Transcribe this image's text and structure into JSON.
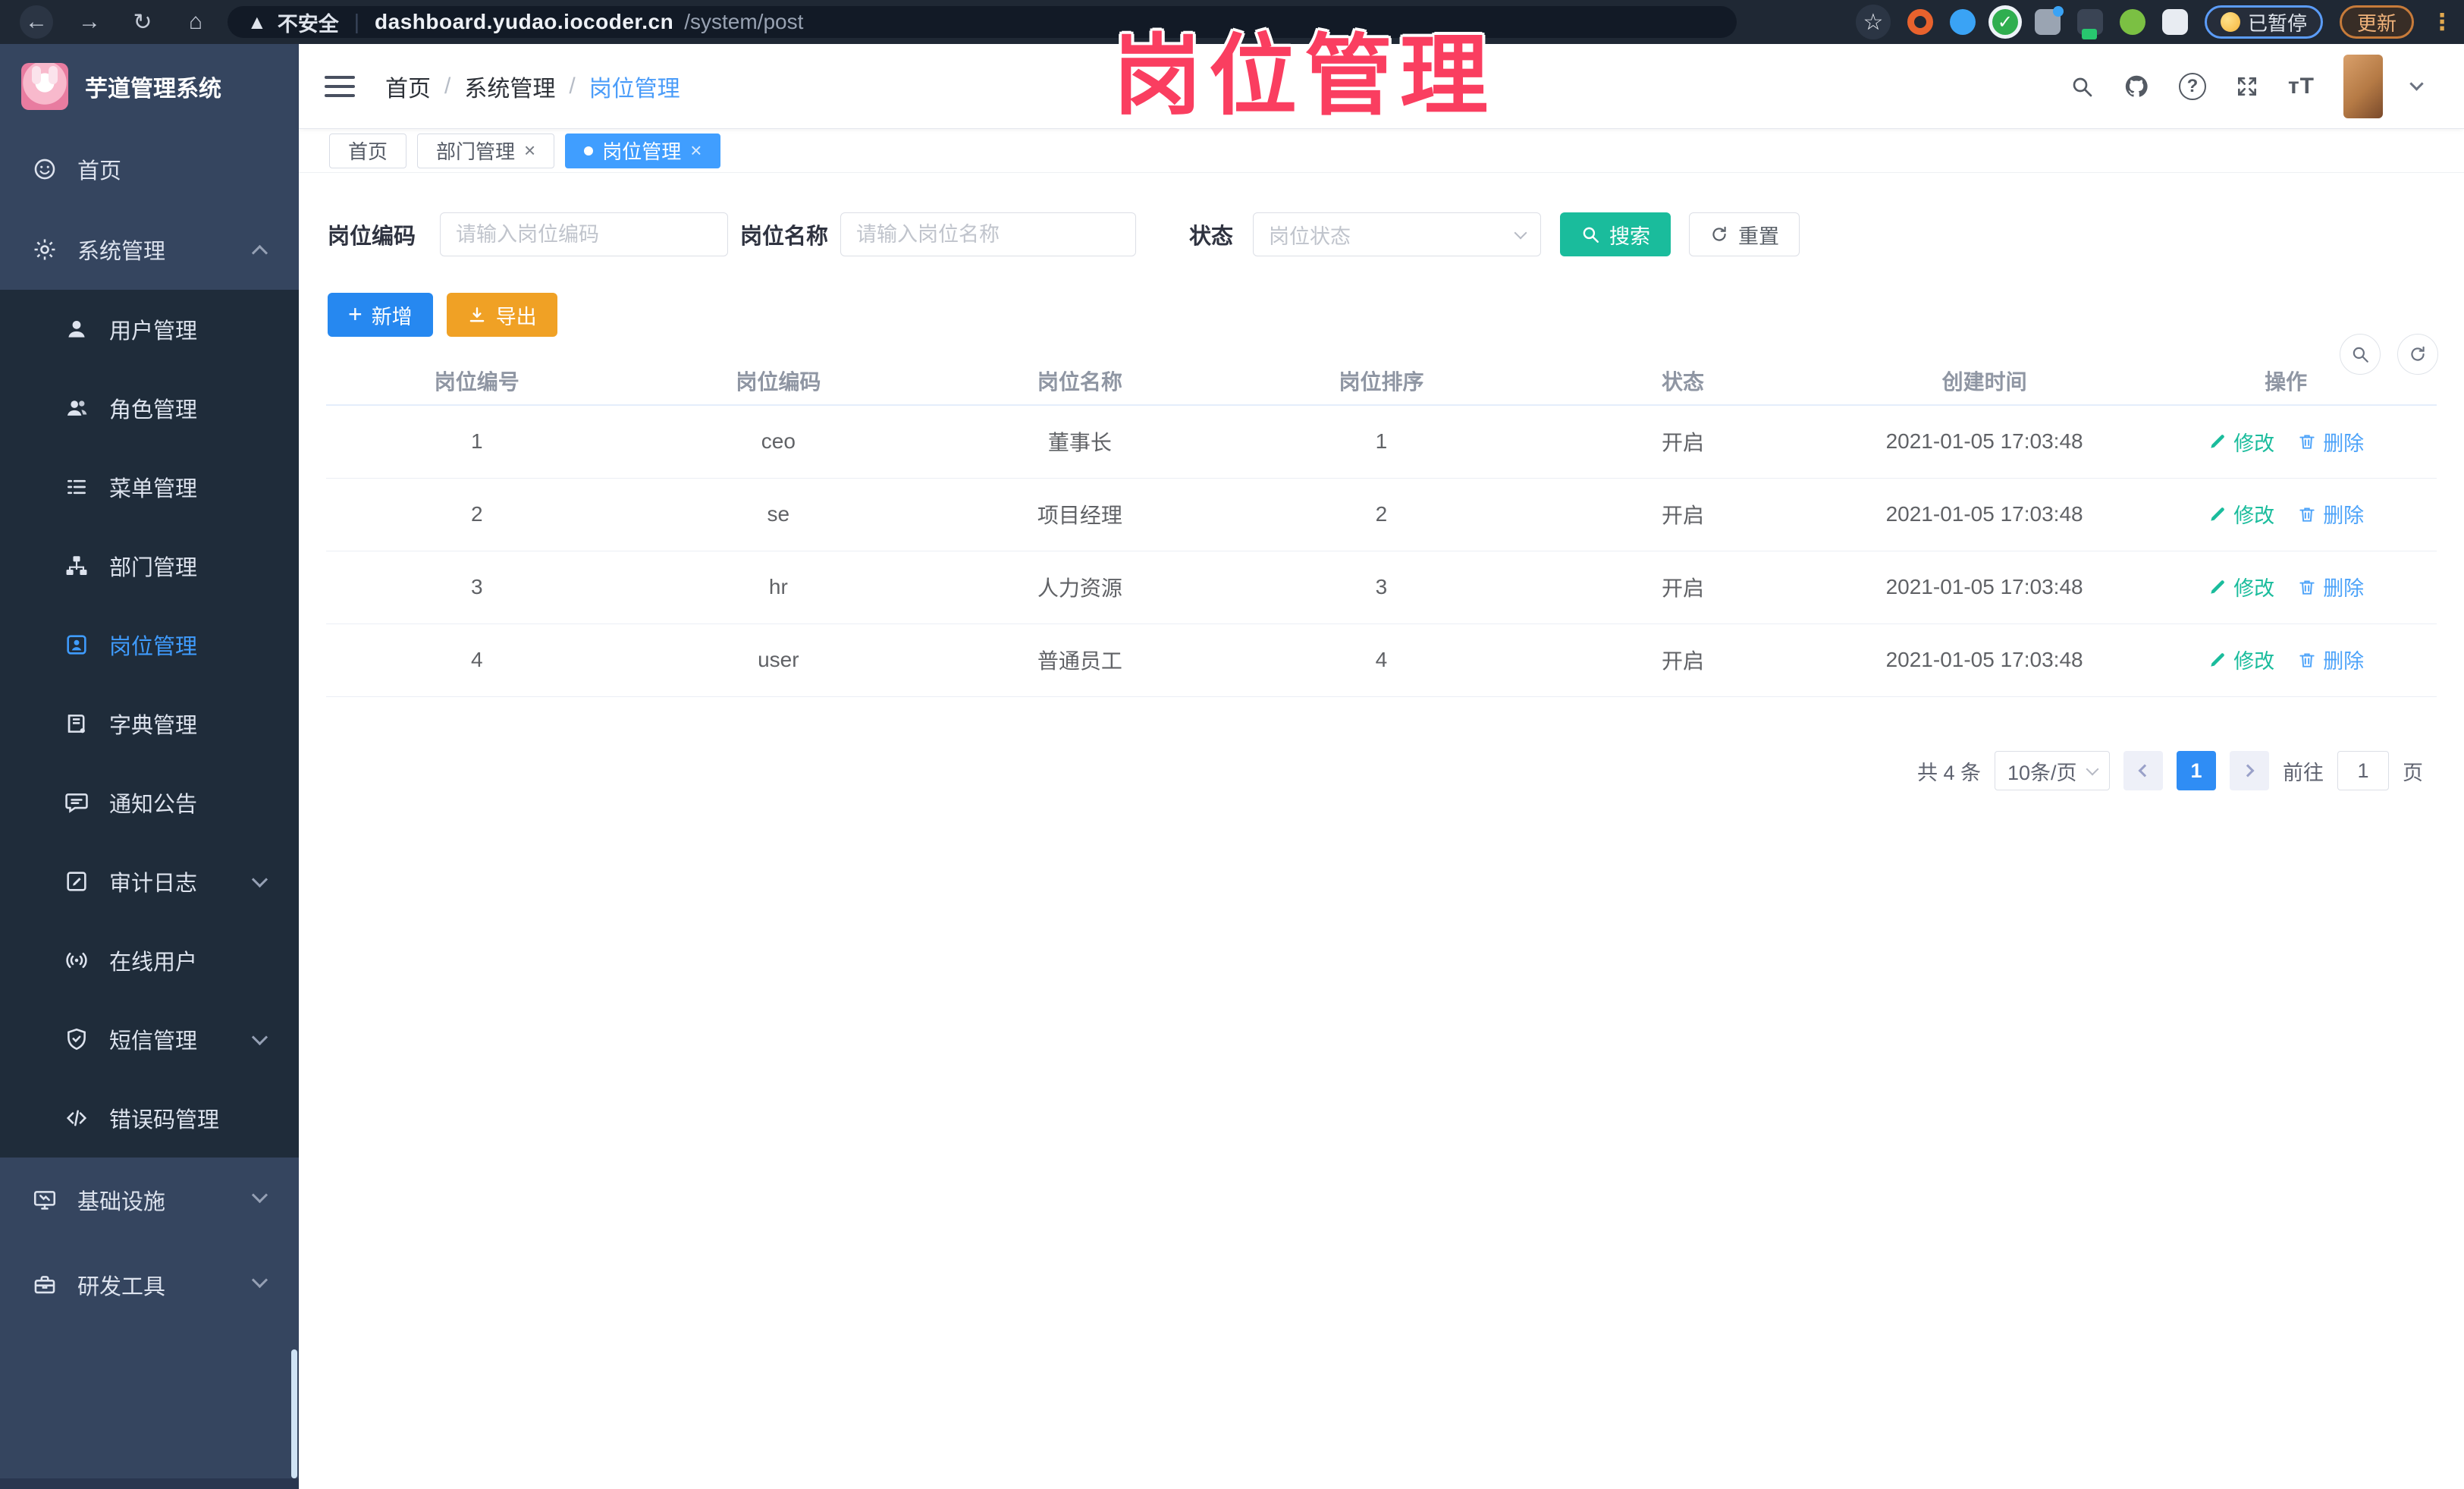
{
  "browser": {
    "security_label": "不安全",
    "url_domain": "dashboard.yudao.iocoder.cn",
    "url_path": "/system/post",
    "paused_label": "已暂停",
    "update_label": "更新"
  },
  "overlay_title": "岗位管理",
  "sidebar": {
    "app_title": "芋道管理系统",
    "items": [
      {
        "label": "首页",
        "icon": "home-icon",
        "type": "root"
      },
      {
        "label": "系统管理",
        "icon": "gear-icon",
        "type": "root",
        "chevron": "up"
      },
      {
        "label": "用户管理",
        "icon": "user-icon",
        "type": "sub"
      },
      {
        "label": "角色管理",
        "icon": "users-icon",
        "type": "sub"
      },
      {
        "label": "菜单管理",
        "icon": "list-icon",
        "type": "sub"
      },
      {
        "label": "部门管理",
        "icon": "tree-icon",
        "type": "sub"
      },
      {
        "label": "岗位管理",
        "icon": "badge-icon",
        "type": "sub",
        "active": true
      },
      {
        "label": "字典管理",
        "icon": "book-icon",
        "type": "sub"
      },
      {
        "label": "通知公告",
        "icon": "chat-icon",
        "type": "sub"
      },
      {
        "label": "审计日志",
        "icon": "auditlog-icon",
        "type": "sub",
        "chevron": "down"
      },
      {
        "label": "在线用户",
        "icon": "online-icon",
        "type": "sub"
      },
      {
        "label": "短信管理",
        "icon": "shield-icon",
        "type": "sub",
        "chevron": "down"
      },
      {
        "label": "错误码管理",
        "icon": "code-icon",
        "type": "sub"
      },
      {
        "label": "基础设施",
        "icon": "monitor-icon",
        "type": "root-lower",
        "chevron": "down"
      },
      {
        "label": "研发工具",
        "icon": "toolbox-icon",
        "type": "root-lower",
        "chevron": "down"
      }
    ]
  },
  "breadcrumb": {
    "items": [
      "首页",
      "系统管理",
      "岗位管理"
    ]
  },
  "tabs": [
    {
      "label": "首页",
      "closable": false,
      "active": false
    },
    {
      "label": "部门管理",
      "closable": true,
      "active": false
    },
    {
      "label": "岗位管理",
      "closable": true,
      "active": true
    }
  ],
  "filters": {
    "post_code_label": "岗位编码",
    "post_code_placeholder": "请输入岗位编码",
    "post_name_label": "岗位名称",
    "post_name_placeholder": "请输入岗位名称",
    "status_label": "状态",
    "status_placeholder": "岗位状态",
    "search_label": "搜索",
    "reset_label": "重置"
  },
  "toolbar": {
    "add_label": "新增",
    "export_label": "导出"
  },
  "table": {
    "columns": [
      "岗位编号",
      "岗位编码",
      "岗位名称",
      "岗位排序",
      "状态",
      "创建时间",
      "操作"
    ],
    "rows": [
      {
        "id": "1",
        "code": "ceo",
        "name": "董事长",
        "sort": "1",
        "status": "开启",
        "created": "2021-01-05 17:03:48"
      },
      {
        "id": "2",
        "code": "se",
        "name": "项目经理",
        "sort": "2",
        "status": "开启",
        "created": "2021-01-05 17:03:48"
      },
      {
        "id": "3",
        "code": "hr",
        "name": "人力资源",
        "sort": "3",
        "status": "开启",
        "created": "2021-01-05 17:03:48"
      },
      {
        "id": "4",
        "code": "user",
        "name": "普通员工",
        "sort": "4",
        "status": "开启",
        "created": "2021-01-05 17:03:48"
      }
    ],
    "edit_label": "修改",
    "delete_label": "删除"
  },
  "pagination": {
    "total_label": "共 4 条",
    "page_size": "10条/页",
    "current_page": "1",
    "goto_label": "前往",
    "goto_value": "1",
    "page_unit": "页"
  },
  "colors": {
    "primary": "#409EFF",
    "teal": "#1abc9c",
    "warning_orange": "#f0a125",
    "annotation_pink": "#fa3e60",
    "sidebar_bg": "#35455f",
    "sidebar_sub_bg": "#1f2c3a"
  }
}
